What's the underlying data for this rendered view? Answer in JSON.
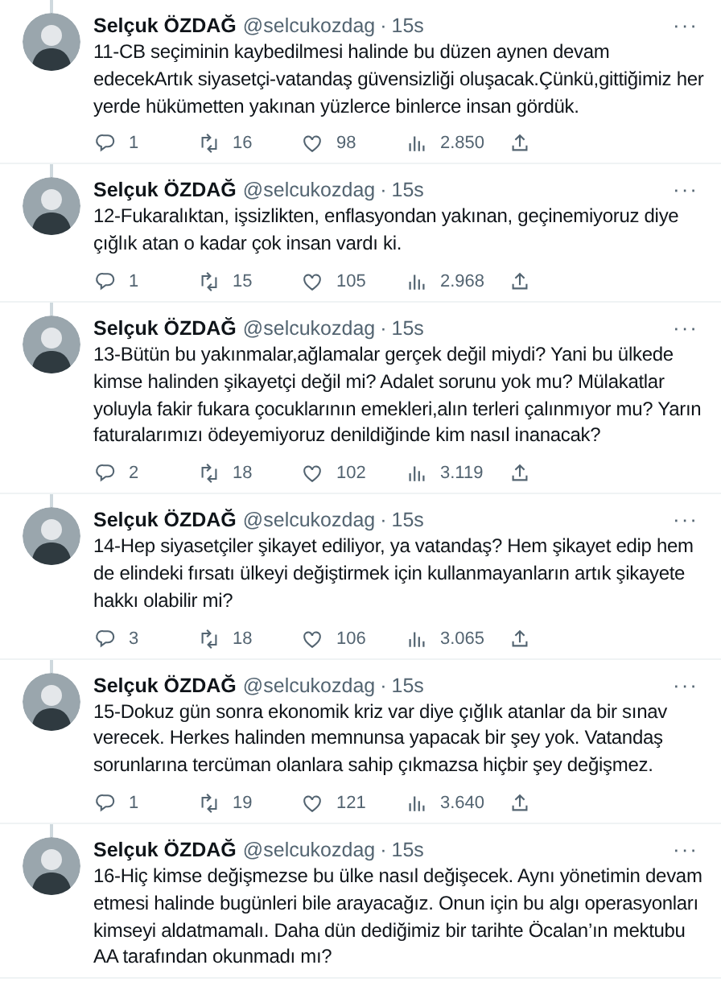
{
  "separator": "·",
  "more": "···",
  "tweets": [
    {
      "name": "Selçuk ÖZDAĞ",
      "handle": "@selcukozdag",
      "time": "15s",
      "text": "11-CB seçiminin kaybedilmesi halinde bu düzen aynen devam edecekArtık siyasetçi-vatandaş güvensizliği oluşacak.Çünkü,gittiğimiz her yerde hükümetten yakınan yüzlerce binlerce insan gördük.",
      "actions": {
        "replies": "1",
        "retweets": "16",
        "likes": "98",
        "views": "2.850"
      }
    },
    {
      "name": "Selçuk ÖZDAĞ",
      "handle": "@selcukozdag",
      "time": "15s",
      "text": "12-Fukaralıktan, işsizlikten, enflasyondan yakınan, geçinemiyoruz diye çığlık atan o kadar çok insan vardı ki.",
      "actions": {
        "replies": "1",
        "retweets": "15",
        "likes": "105",
        "views": "2.968"
      }
    },
    {
      "name": "Selçuk ÖZDAĞ",
      "handle": "@selcukozdag",
      "time": "15s",
      "text": "13-Bütün bu yakınmalar,ağlamalar gerçek değil miydi? Yani bu ülkede kimse halinden şikayetçi değil mi? Adalet sorunu yok mu? Mülakatlar yoluyla fakir fukara çocuklarının emekleri,alın terleri çalınmıyor mu? Yarın faturalarımızı ödeyemiyoruz denildiğinde kim nasıl inanacak?",
      "actions": {
        "replies": "2",
        "retweets": "18",
        "likes": "102",
        "views": "3.119"
      }
    },
    {
      "name": "Selçuk ÖZDAĞ",
      "handle": "@selcukozdag",
      "time": "15s",
      "text": "14-Hep siyasetçiler şikayet ediliyor, ya vatandaş? Hem şikayet edip hem de elindeki fırsatı ülkeyi değiştirmek için kullanmayanların artık şikayete hakkı olabilir mi?",
      "actions": {
        "replies": "3",
        "retweets": "18",
        "likes": "106",
        "views": "3.065"
      }
    },
    {
      "name": "Selçuk ÖZDAĞ",
      "handle": "@selcukozdag",
      "time": "15s",
      "text": "15-Dokuz gün sonra ekonomik kriz var diye çığlık atanlar da bir sınav verecek. Herkes halinden memnunsa yapacak bir şey yok. Vatandaş sorunlarına tercüman olanlara sahip çıkmazsa hiçbir şey değişmez.",
      "actions": {
        "replies": "1",
        "retweets": "19",
        "likes": "121",
        "views": "3.640"
      }
    },
    {
      "name": "Selçuk ÖZDAĞ",
      "handle": "@selcukozdag",
      "time": "15s",
      "text": "16-Hiç kimse değişmezse bu ülke nasıl değişecek. Aynı yönetimin devam etmesi halinde bugünleri bile arayacağız. Onun için bu algı operasyonları kimseyi aldatmamalı. Daha dün dediğimiz bir tarihte Öcalan’ın mektubu AA tarafından okunmadı mı?"
    }
  ]
}
